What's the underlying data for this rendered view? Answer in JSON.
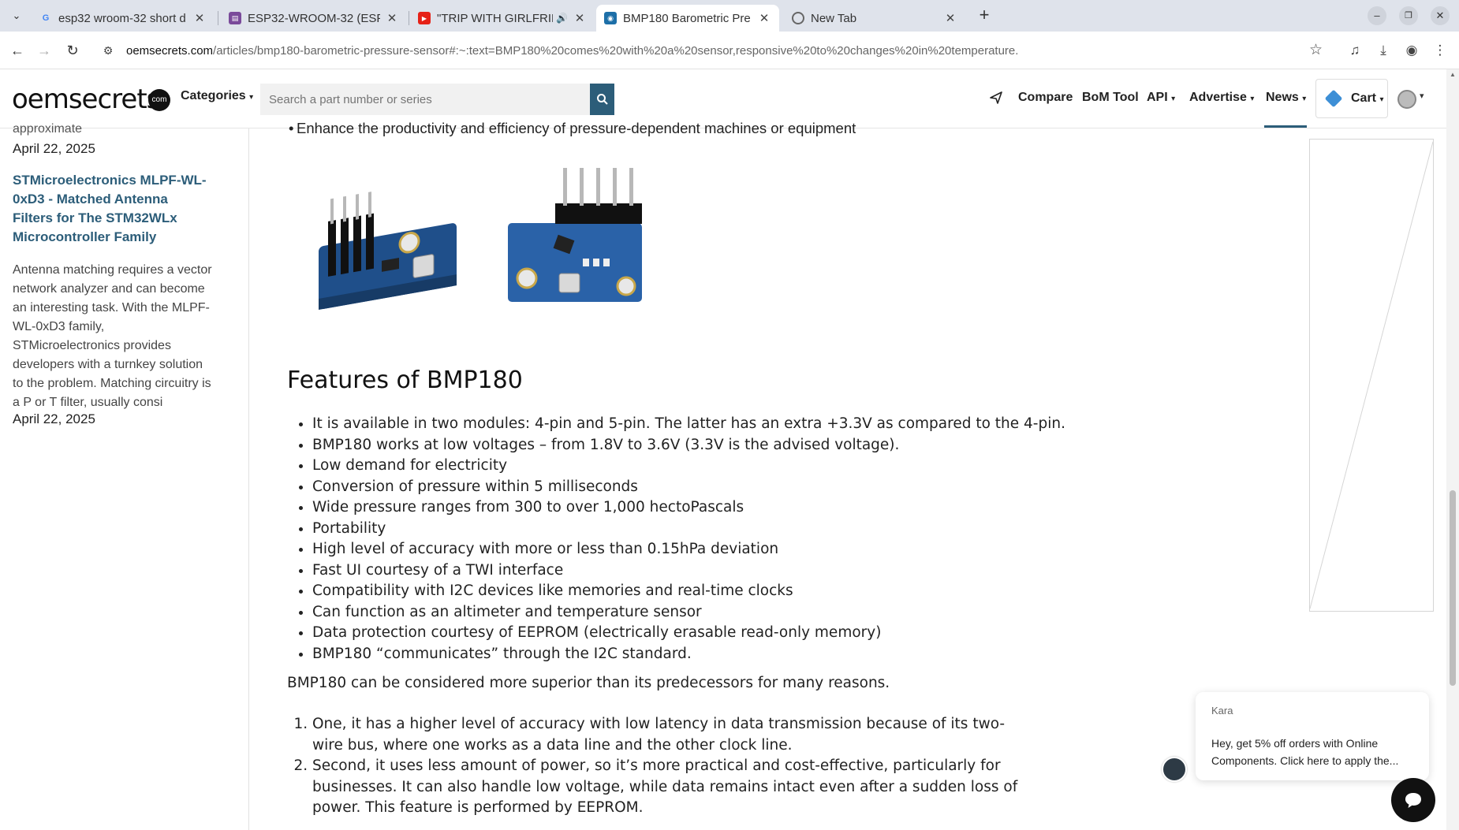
{
  "browser": {
    "tabs": [
      {
        "title": "esp32 wroom-32 short d",
        "favicon": "google-icon",
        "active": false
      },
      {
        "title": "ESP32-WROOM-32 (ESP",
        "favicon": "book-icon",
        "active": false
      },
      {
        "title": "\"TRIP WITH GIRLFRIE",
        "favicon": "youtube-icon",
        "active": false,
        "audio": true
      },
      {
        "title": "BMP180 Barometric Pre",
        "favicon": "oemsecrets-icon",
        "active": true
      },
      {
        "title": "New Tab",
        "favicon": "chrome-icon",
        "active": false
      }
    ],
    "url_host": "oemsecrets.com",
    "url_path": "/articles/bmp180-barometric-pressure-sensor#:~:text=BMP180%20comes%20with%20a%20sensor,responsive%20to%20changes%20in%20temperature."
  },
  "header": {
    "logo": "oemsecrets",
    "logo_badge": "com",
    "categories_label": "Categories",
    "search_placeholder": "Search a part number or series",
    "nav": {
      "compare": "Compare",
      "bom_tool": "BoM Tool",
      "api": "API",
      "advertise": "Advertise",
      "news": "News",
      "cart": "Cart"
    }
  },
  "sidebar": {
    "cut_text": "approximate",
    "date1": "April 22, 2025",
    "article_title": "STMicroelectronics MLPF-WL-0xD3 - Matched Antenna Filters for The STM32WLx Microcontroller Family",
    "article_excerpt": "Antenna matching requires a vector network analyzer and can become an interesting task. With the MLPF-WL-0xD3 family, STMicroelectronics provides developers with a turnkey solution to the problem. Matching circuitry is a P or T filter, usually consi",
    "date2": "April 22, 2025"
  },
  "article": {
    "cut_bullet": "Enhance the productivity and efficiency of pressure-dependent machines or equipment",
    "features_heading": "Features of BMP180",
    "features": [
      "It is available in two modules: 4-pin and 5-pin. The latter has an extra +3.3V as compared to the 4-pin.",
      "BMP180 works at low voltages – from 1.8V to 3.6V (3.3V is the advised voltage).",
      "Low demand for electricity",
      "Conversion of pressure within 5 milliseconds",
      "Wide pressure ranges from 300 to over 1,000 hectoPascals",
      "Portability",
      "High level of accuracy with more or less than 0.15hPa deviation",
      "Fast UI courtesy of a TWI interface",
      "Compatibility with I2C devices like memories and real-time clocks",
      "Can function as an altimeter and temperature sensor",
      "Data protection courtesy of EEPROM (electrically erasable read-only memory)",
      "BMP180 “communicates” through the I2C standard."
    ],
    "reasons_intro": "BMP180 can be considered more superior than its predecessors for many reasons.",
    "reasons": [
      "One, it has a higher level of accuracy with low latency in data transmission because of its two-wire bus, where one works as a data line and the other clock line.",
      "Second, it uses less amount of power, so it’s more practical and cost-effective, particularly for businesses. It can also handle low voltage, while data remains intact even after a sudden loss of power. This feature is performed by EEPROM."
    ]
  },
  "chat": {
    "agent_name": "Kara",
    "message": "Hey, get 5% off orders with Online Components. Click here to apply the..."
  },
  "colors": {
    "brand_blue": "#2c5d79",
    "pcb_blue": "#1f4f8a"
  }
}
